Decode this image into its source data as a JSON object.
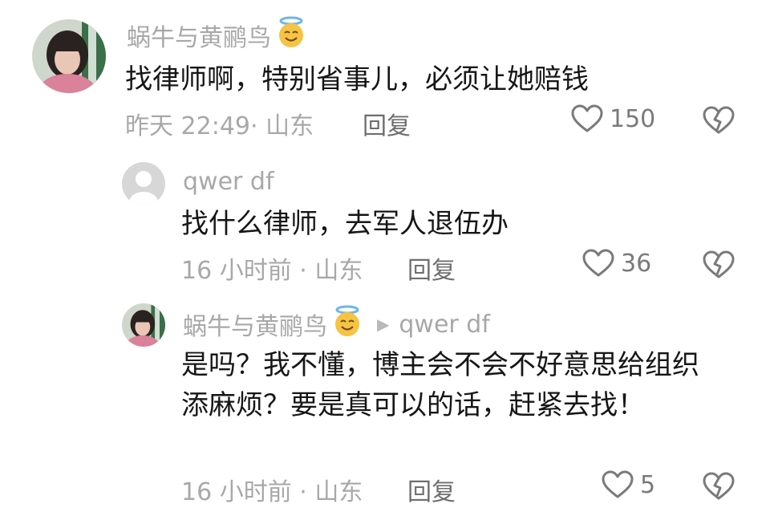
{
  "comments": [
    {
      "author": "蜗牛与黄鹂鸟",
      "text": "找律师啊，特别省事儿，必须让她赔钱",
      "time": "昨天 22:49",
      "location": "山东",
      "reply_label": "回复",
      "likes": "150",
      "avatar_icon": "girl-photo-avatar",
      "author_badge_icon": "halo-smile-emoji-icon"
    },
    {
      "author": "qwer df",
      "text": "找什么律师，去军人退伍办",
      "time": "16 小时前",
      "location": "山东",
      "reply_label": "回复",
      "likes": "36",
      "avatar_icon": "default-user-avatar"
    },
    {
      "author": "蜗牛与黄鹂鸟",
      "reply_to": "qwer df",
      "text": "是吗？我不懂，博主会不会不好意思给组织添麻烦？要是真可以的话，赶紧去找！",
      "time": "16 小时前",
      "location": "山东",
      "reply_label": "回复",
      "likes": "5",
      "avatar_icon": "girl-photo-avatar",
      "author_badge_icon": "halo-smile-emoji-icon"
    }
  ],
  "colors": {
    "meta_gray": "#a8a8a8",
    "text": "#161616",
    "icon_gray": "#7a7a7a"
  }
}
